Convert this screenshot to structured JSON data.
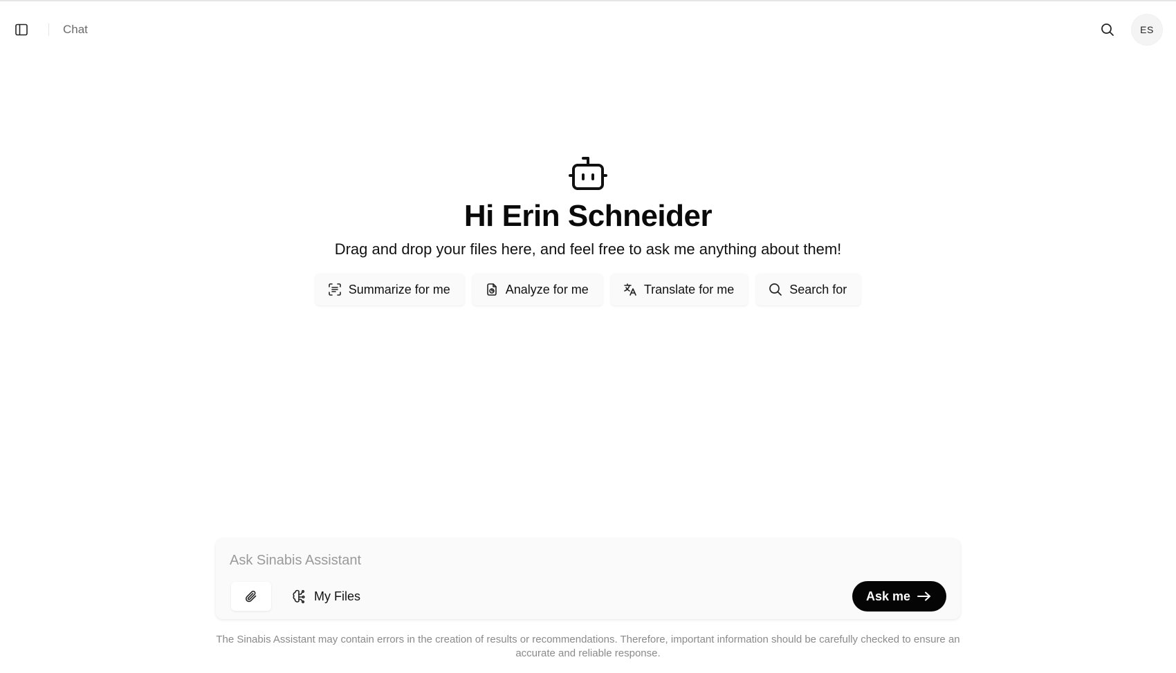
{
  "header": {
    "breadcrumb": "Chat",
    "avatar_initials": "ES"
  },
  "hero": {
    "greeting": "Hi Erin Schneider",
    "subtitle": "Drag and drop your files here, and feel free to ask me anything about them!",
    "actions": [
      {
        "label": "Summarize for me",
        "icon": "summarize-icon"
      },
      {
        "label": "Analyze for me",
        "icon": "analyze-icon"
      },
      {
        "label": "Translate for me",
        "icon": "translate-icon"
      },
      {
        "label": "Search for",
        "icon": "search-icon"
      }
    ]
  },
  "composer": {
    "placeholder": "Ask Sinabis Assistant",
    "value": "",
    "files_label": "My Files",
    "submit_label": "Ask me"
  },
  "disclaimer": "The Sinabis Assistant may contain errors in the creation of results or recommendations. Therefore, important information should be carefully checked to ensure an accurate and reliable response.",
  "colors": {
    "accent": "#050505",
    "muted_text": "#8a8a8a",
    "surface": "#fafafa"
  }
}
